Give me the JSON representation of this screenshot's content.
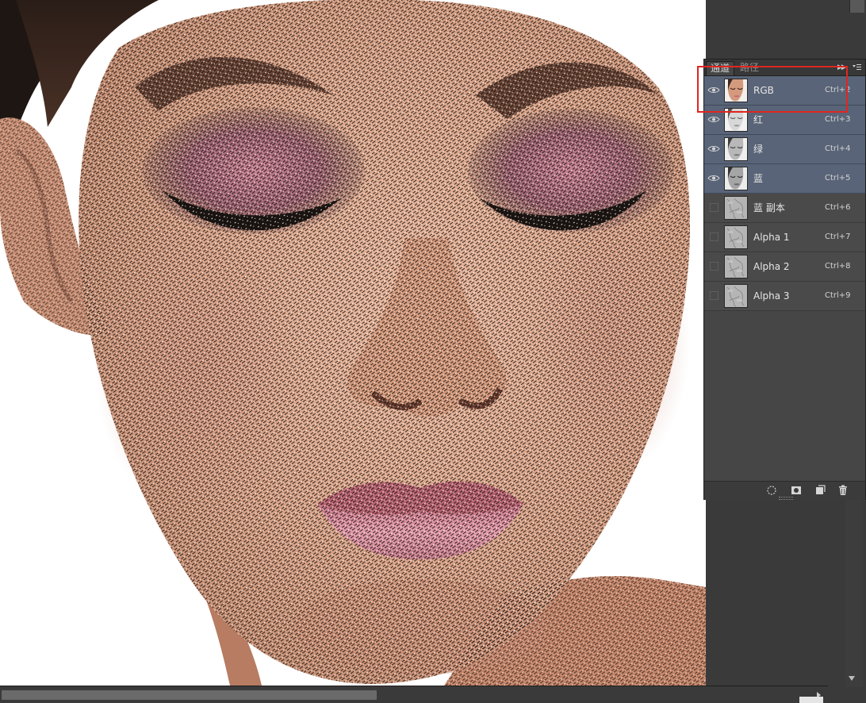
{
  "panel": {
    "tabs": [
      {
        "label": "通道",
        "active": true
      },
      {
        "label": "路径",
        "active": false
      }
    ],
    "channels": [
      {
        "name": "RGB",
        "shortcut": "Ctrl+2",
        "visible": true,
        "selected": true,
        "thumbnail": "color-face"
      },
      {
        "name": "红",
        "shortcut": "Ctrl+3",
        "visible": true,
        "selected": true,
        "thumbnail": "gray-face-light"
      },
      {
        "name": "绿",
        "shortcut": "Ctrl+4",
        "visible": true,
        "selected": true,
        "thumbnail": "gray-face"
      },
      {
        "name": "蓝",
        "shortcut": "Ctrl+5",
        "visible": true,
        "selected": true,
        "thumbnail": "gray-face-dark"
      },
      {
        "name": "蓝 副本",
        "shortcut": "Ctrl+6",
        "visible": false,
        "selected": false,
        "thumbnail": "gray-texture"
      },
      {
        "name": "Alpha 1",
        "shortcut": "Ctrl+7",
        "visible": false,
        "selected": false,
        "thumbnail": "gray-texture"
      },
      {
        "name": "Alpha 2",
        "shortcut": "Ctrl+8",
        "visible": false,
        "selected": false,
        "thumbnail": "gray-texture"
      },
      {
        "name": "Alpha 3",
        "shortcut": "Ctrl+9",
        "visible": false,
        "selected": false,
        "thumbnail": "gray-texture"
      }
    ],
    "footer_buttons": [
      {
        "icon": "load-channel-as-selection-icon"
      },
      {
        "icon": "save-selection-as-channel-icon"
      },
      {
        "icon": "new-channel-icon"
      },
      {
        "icon": "delete-channel-icon"
      }
    ]
  },
  "colors": {
    "selected_row": "#596478",
    "highlight": "#e0261f",
    "panel_bg": "#464646"
  },
  "icons": {
    "eye": "eye-icon",
    "menu": "panel-menu-icon",
    "expand": "panel-expand-icon"
  }
}
